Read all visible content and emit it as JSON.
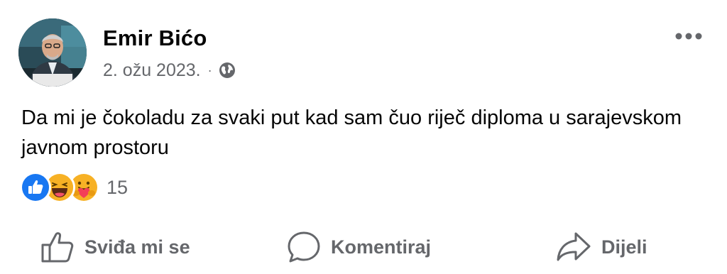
{
  "post": {
    "author": "Emir Bićo",
    "date": "2. ožu 2023.",
    "separator": "·",
    "audience_icon": "globe-icon",
    "more_icon": "more-options-icon",
    "text": "Da mi je čokoladu za svaki put kad sam čuo riječ diploma u sarajevskom javnom prostoru",
    "reactions": {
      "icons": [
        "like-reaction-icon",
        "haha-reaction-icon",
        "care-reaction-icon"
      ],
      "count": "15"
    }
  },
  "actions": {
    "like_label": "Sviđa mi se",
    "comment_label": "Komentiraj",
    "share_label": "Dijeli"
  },
  "colors": {
    "text_primary": "#050505",
    "text_secondary": "#65676b",
    "like_blue": "#1877f2",
    "emoji_yellow": "#f7b125",
    "heart_red": "#f33e58"
  }
}
